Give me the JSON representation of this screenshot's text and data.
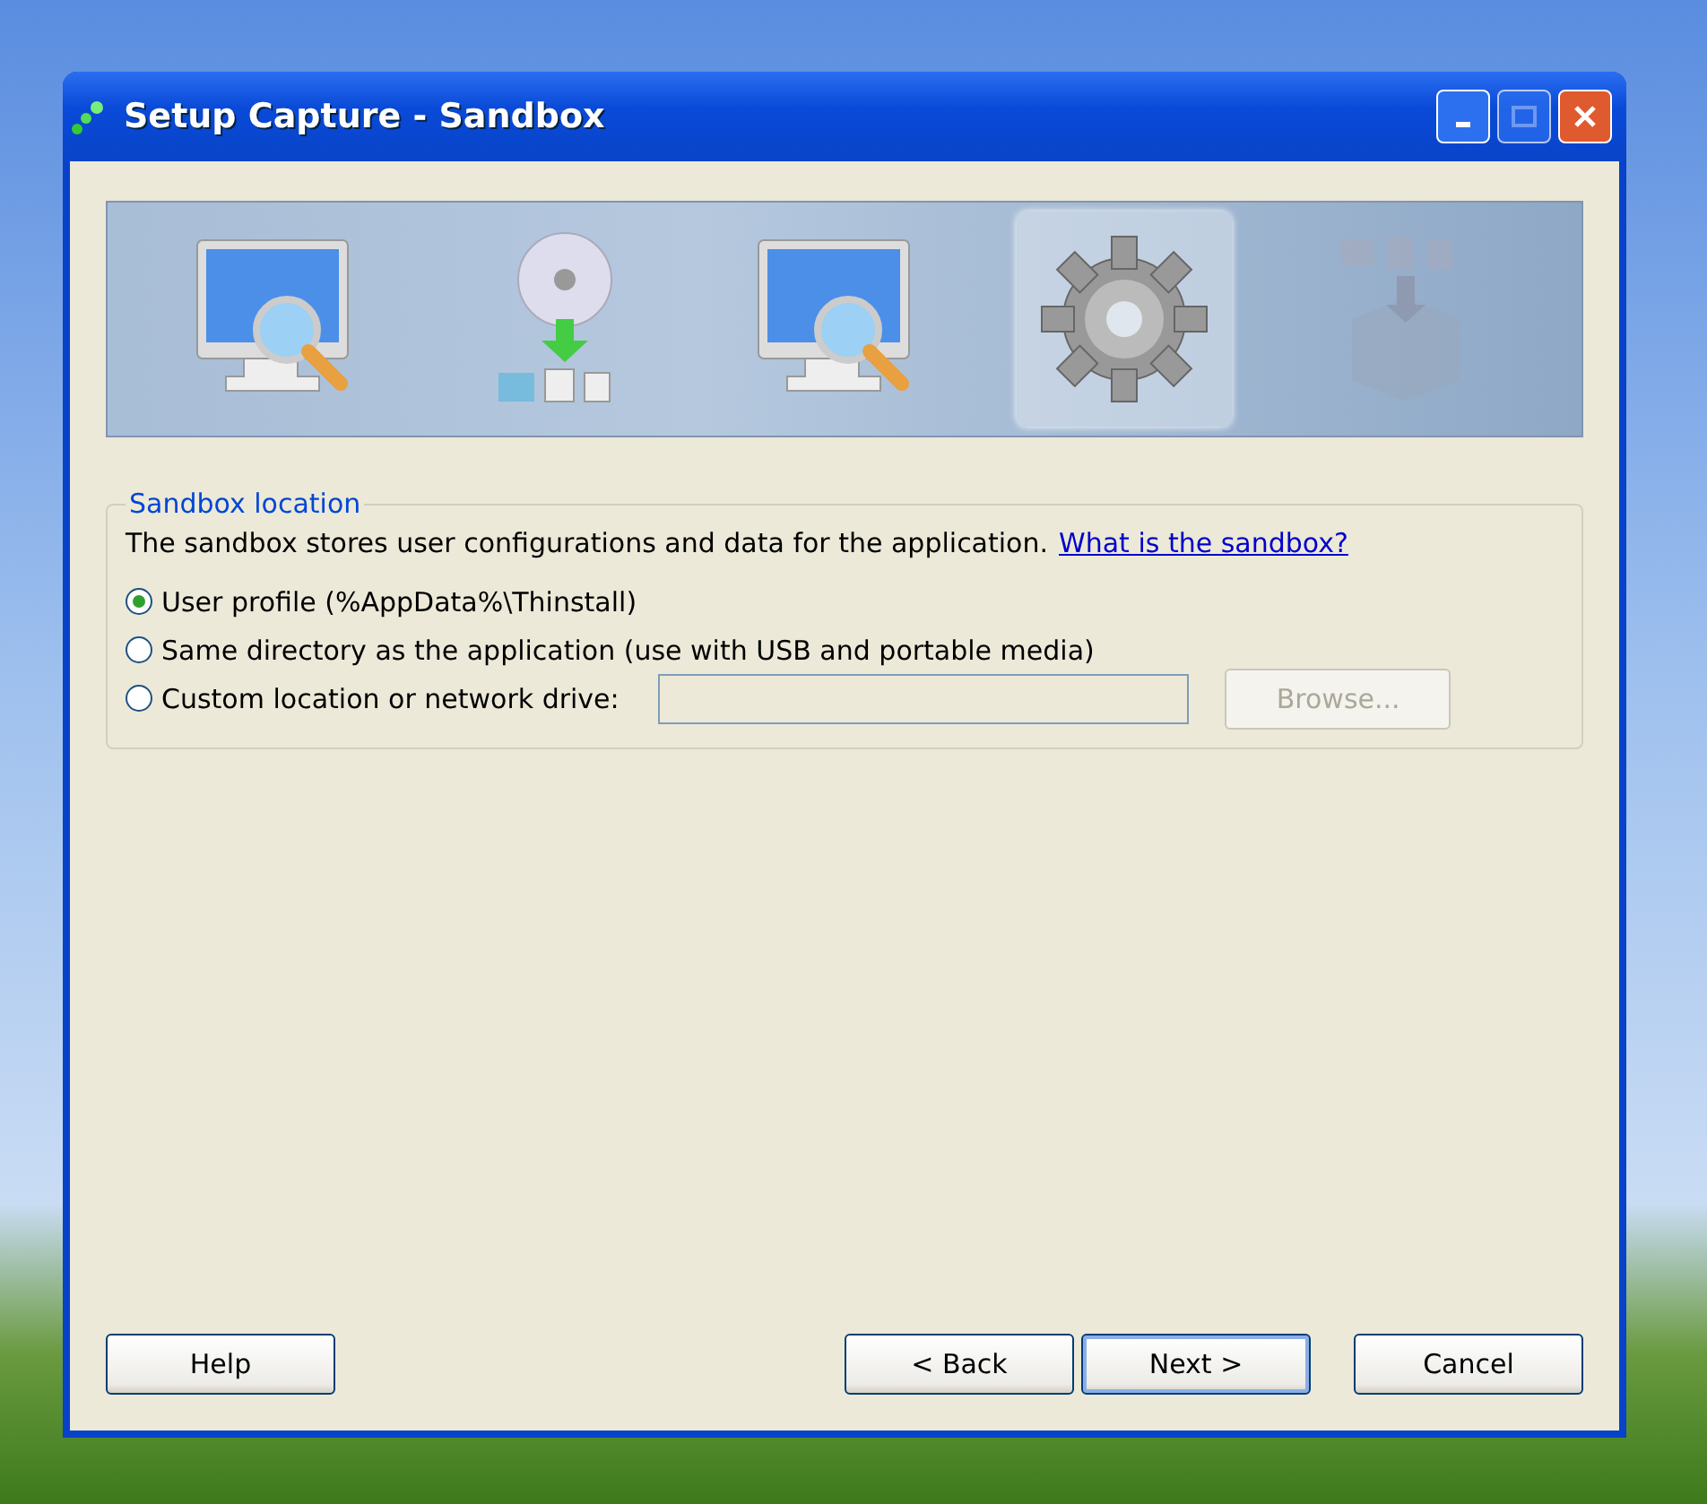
{
  "window": {
    "title": "Setup Capture - Sandbox"
  },
  "steps": [
    {
      "kind": "monitor-search",
      "selected": false,
      "disabled": false
    },
    {
      "kind": "disc-install",
      "selected": false,
      "disabled": false
    },
    {
      "kind": "monitor-search",
      "selected": false,
      "disabled": false
    },
    {
      "kind": "gear",
      "selected": true,
      "disabled": false
    },
    {
      "kind": "box",
      "selected": false,
      "disabled": true
    }
  ],
  "group": {
    "title": "Sandbox location",
    "description": "The sandbox stores user configurations and data for the application.",
    "link": "What is the sandbox?",
    "options": [
      {
        "label": "User profile (%AppData%\\Thinstall)",
        "selected": true
      },
      {
        "label": "Same directory as the application (use with USB and portable media)",
        "selected": false
      },
      {
        "label": "Custom location or network drive:",
        "selected": false
      }
    ],
    "custom_path": {
      "disabled": true
    },
    "browse": {
      "label": "Browse...",
      "disabled": true
    }
  },
  "buttons": [
    {
      "label": "Help",
      "default": false
    },
    {
      "label": "< Back",
      "default": false
    },
    {
      "label": "Next >",
      "default": true
    },
    {
      "label": "Cancel",
      "default": false
    }
  ]
}
